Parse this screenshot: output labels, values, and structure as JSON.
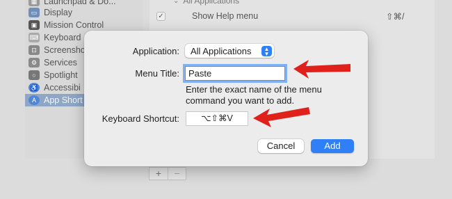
{
  "background": {
    "sidebar": {
      "items": [
        {
          "label": "Launchpad & Do...",
          "icon": "launchpad-icon",
          "color": "#9a9a9a"
        },
        {
          "label": "Display",
          "icon": "display-icon",
          "color": "#6f8fb8"
        },
        {
          "label": "Mission Control",
          "icon": "mission-control-icon",
          "color": "#555555"
        },
        {
          "label": "Keyboard",
          "icon": "keyboard-icon",
          "color": "#aaaaaa"
        },
        {
          "label": "Screensho",
          "icon": "screenshot-icon",
          "color": "#888888"
        },
        {
          "label": "Services",
          "icon": "gear-icon",
          "color": "#8a8a8a"
        },
        {
          "label": "Spotlight",
          "icon": "spotlight-icon",
          "color": "#777777"
        },
        {
          "label": "Accessibi",
          "icon": "accessibility-icon",
          "color": "#4f86d6"
        },
        {
          "label": "App Short",
          "icon": "app-store-icon",
          "color": "#4f86d6",
          "selected": true
        }
      ]
    },
    "shortcuts_list": {
      "group_label": "All Applications",
      "rows": [
        {
          "label": "Show Help menu",
          "shortcut": "⇧⌘/",
          "checked": true
        }
      ]
    },
    "add_remove": {
      "add": "+",
      "remove": "−"
    }
  },
  "dialog": {
    "application_label": "Application:",
    "application_value": "All Applications",
    "menu_title_label": "Menu Title:",
    "menu_title_value": "Paste",
    "help_text_line1": "Enter the exact name of the menu",
    "help_text_line2": "command you want to add.",
    "keyboard_shortcut_label": "Keyboard Shortcut:",
    "keyboard_shortcut_value": "⌥⇧⌘V",
    "cancel_label": "Cancel",
    "add_label": "Add"
  },
  "colors": {
    "accent": "#2f7ff7",
    "annotation_arrow": "#e0201b",
    "focus_ring": "#7fb2f5"
  }
}
